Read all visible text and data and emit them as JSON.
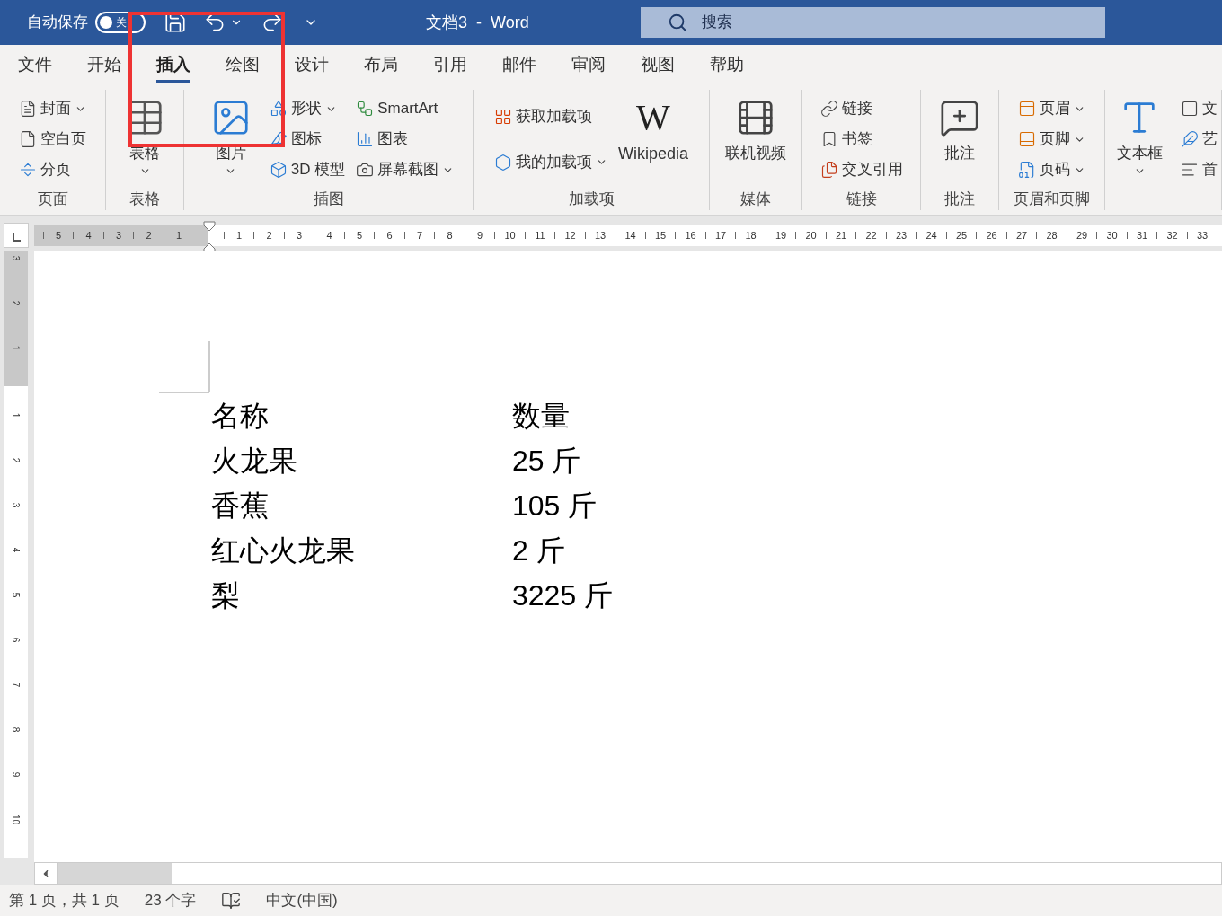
{
  "title_bar": {
    "autosave_label": "自动保存",
    "autosave": {
      "on": false,
      "label": "关"
    },
    "document_title": "文档3  -  Word",
    "search": {
      "placeholder": "搜索"
    }
  },
  "tabs": [
    {
      "label": "文件",
      "selected": false
    },
    {
      "label": "开始",
      "selected": false
    },
    {
      "label": "插入",
      "selected": true
    },
    {
      "label": "绘图",
      "selected": false
    },
    {
      "label": "设计",
      "selected": false
    },
    {
      "label": "布局",
      "selected": false
    },
    {
      "label": "引用",
      "selected": false
    },
    {
      "label": "邮件",
      "selected": false
    },
    {
      "label": "审阅",
      "selected": false
    },
    {
      "label": "视图",
      "selected": false
    },
    {
      "label": "帮助",
      "selected": false
    }
  ],
  "ribbon": {
    "groups": [
      {
        "label": "页面",
        "items": [
          {
            "kind": "stack",
            "rows": [
              {
                "label": "封面",
                "dropdown": true
              },
              {
                "label": "空白页",
                "dropdown": false
              },
              {
                "label": "分页",
                "dropdown": false
              }
            ]
          }
        ]
      },
      {
        "label": "表格",
        "items": [
          {
            "kind": "big",
            "label": "表格",
            "dropdown": true
          }
        ]
      },
      {
        "label": "插图",
        "items": [
          {
            "kind": "big",
            "label": "图片",
            "dropdown": true
          },
          {
            "kind": "stack",
            "rows": [
              {
                "label": "形状",
                "dropdown": true
              },
              {
                "label": "图标",
                "dropdown": false
              },
              {
                "label": "3D 模型",
                "dropdown": false
              }
            ]
          },
          {
            "kind": "stack",
            "rows": [
              {
                "label": "SmartArt",
                "dropdown": false
              },
              {
                "label": "图表",
                "dropdown": false
              },
              {
                "label": "屏幕截图",
                "dropdown": true
              }
            ]
          }
        ]
      },
      {
        "label": "加载项",
        "items": [
          {
            "kind": "stack",
            "rows": [
              {
                "label": "获取加载项",
                "dropdown": false
              },
              {
                "label": "我的加载项",
                "dropdown": true
              }
            ]
          },
          {
            "kind": "logo",
            "logo": "W",
            "label": "Wikipedia"
          }
        ]
      },
      {
        "label": "媒体",
        "items": [
          {
            "kind": "big",
            "label": "联机视频",
            "dropdown": false
          }
        ]
      },
      {
        "label": "链接",
        "items": [
          {
            "kind": "stack",
            "rows": [
              {
                "label": "链接",
                "dropdown": false
              },
              {
                "label": "书签",
                "dropdown": false
              },
              {
                "label": "交叉引用",
                "dropdown": false
              }
            ]
          }
        ]
      },
      {
        "label": "批注",
        "items": [
          {
            "kind": "big",
            "label": "批注",
            "dropdown": false
          }
        ]
      },
      {
        "label": "页眉和页脚",
        "items": [
          {
            "kind": "stack",
            "rows": [
              {
                "label": "页眉",
                "dropdown": true
              },
              {
                "label": "页脚",
                "dropdown": true
              },
              {
                "label": "页码",
                "dropdown": true
              }
            ]
          }
        ]
      },
      {
        "items": [
          {
            "kind": "big",
            "label": "文本框",
            "dropdown": true
          },
          {
            "kind": "stack",
            "rows": [
              {
                "label": "文",
                "dropdown": false
              },
              {
                "label": "艺",
                "dropdown": false
              },
              {
                "label": "首",
                "dropdown": false
              }
            ]
          }
        ]
      }
    ]
  },
  "ruler": {
    "left_numbers": [
      "5",
      "4",
      "3",
      "2",
      "1"
    ],
    "right_numbers": [
      "1",
      "2",
      "3",
      "4",
      "5",
      "6",
      "7",
      "8",
      "9",
      "10",
      "11",
      "12",
      "13",
      "14",
      "15",
      "16",
      "17",
      "18",
      "19",
      "20",
      "21",
      "22",
      "23",
      "24",
      "25",
      "26",
      "27",
      "28",
      "29",
      "30",
      "31",
      "32",
      "33"
    ]
  },
  "vertical_ruler": {
    "top_numbers": [
      "3",
      "2",
      "1"
    ],
    "numbers": [
      "1",
      "2",
      "3",
      "4",
      "5",
      "6",
      "7",
      "8",
      "9",
      "10"
    ]
  },
  "document": {
    "rows": [
      {
        "name": "名称",
        "quantity": "数量"
      },
      {
        "name": "火龙果",
        "quantity": "25 斤"
      },
      {
        "name": "香蕉",
        "quantity": "105 斤"
      },
      {
        "name": "红心火龙果",
        "quantity": "2 斤"
      },
      {
        "name": "梨",
        "quantity": "3225 斤"
      }
    ]
  },
  "status_bar": {
    "page": "第 1 页，共 1 页",
    "words": "23 个字",
    "language": "中文(中国)"
  }
}
